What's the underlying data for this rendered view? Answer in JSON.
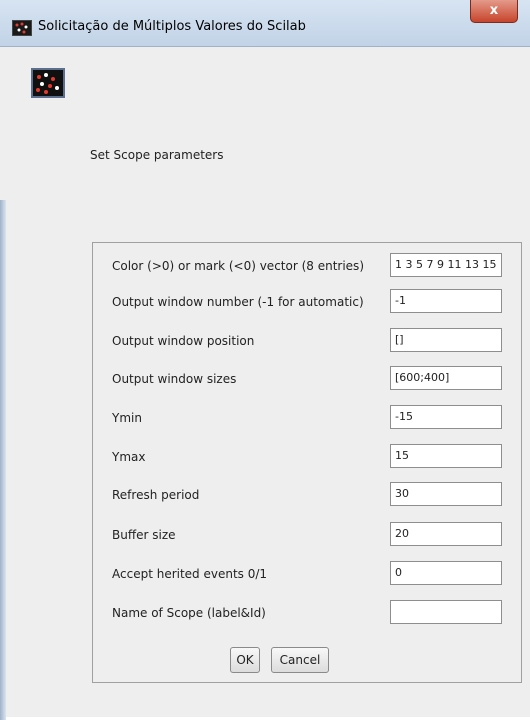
{
  "window": {
    "title": "Solicitação de Múltiplos Valores do Scilab",
    "close_label": "x"
  },
  "heading": "Set Scope parameters",
  "fields": [
    {
      "label": "Color (>0) or mark (<0) vector (8 entries)",
      "value": "1 3 5 7 9 11 13 15"
    },
    {
      "label": "Output window number (-1 for automatic)",
      "value": "-1"
    },
    {
      "label": "Output window position",
      "value": "[]"
    },
    {
      "label": "Output window sizes",
      "value": "[600;400]"
    },
    {
      "label": "Ymin",
      "value": "-15"
    },
    {
      "label": "Ymax",
      "value": "15"
    },
    {
      "label": "Refresh period",
      "value": "30"
    },
    {
      "label": "Buffer size",
      "value": "20"
    },
    {
      "label": "Accept herited events 0/1",
      "value": "0"
    },
    {
      "label": "Name of Scope (label&Id)",
      "value": ""
    }
  ],
  "buttons": {
    "ok": "OK",
    "cancel": "Cancel"
  },
  "icons": {
    "window_icon": "scilab-scope-icon",
    "dialog_icon": "scilab-scope-icon"
  }
}
